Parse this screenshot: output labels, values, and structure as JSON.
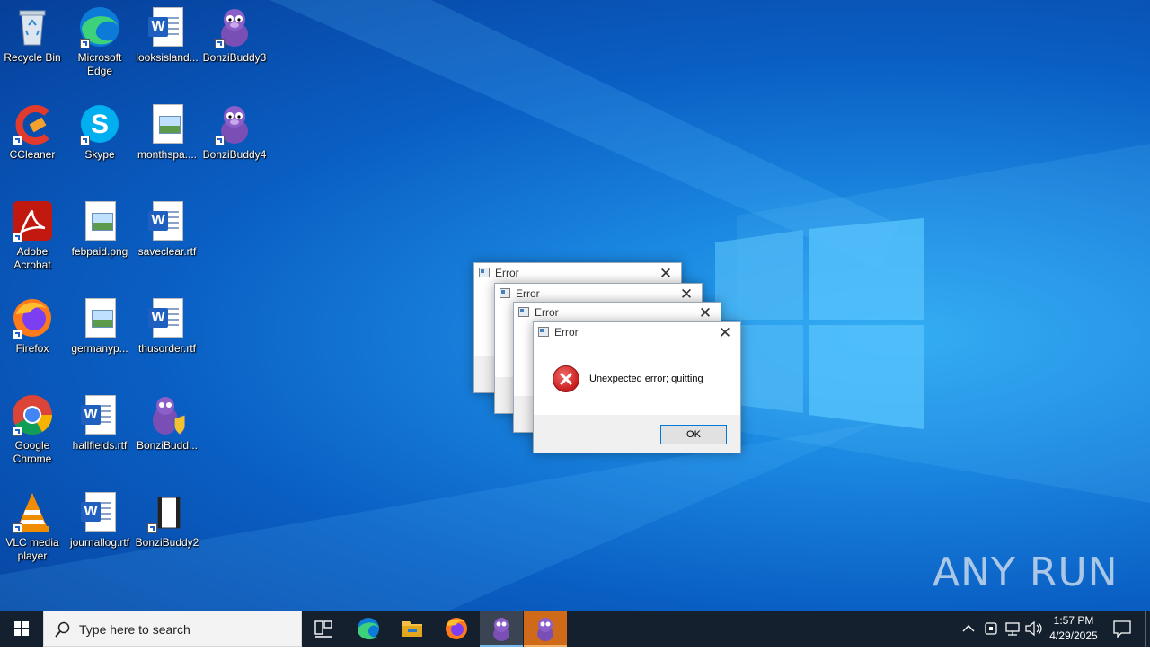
{
  "desktop": {
    "icons": [
      {
        "label": "Recycle Bin",
        "icon": "recycle-bin-icon"
      },
      {
        "label": "Microsoft Edge",
        "icon": "edge-icon"
      },
      {
        "label": "looksisland...",
        "icon": "word-doc-icon"
      },
      {
        "label": "BonziBuddy3",
        "icon": "bonzibuddy-icon"
      },
      {
        "label": "CCleaner",
        "icon": "ccleaner-icon"
      },
      {
        "label": "Skype",
        "icon": "skype-icon"
      },
      {
        "label": "monthspa....",
        "icon": "image-file-icon"
      },
      {
        "label": "BonziBuddy4",
        "icon": "bonzibuddy-icon"
      },
      {
        "label": "Adobe Acrobat",
        "icon": "acrobat-icon"
      },
      {
        "label": "febpaid.png",
        "icon": "image-file-icon"
      },
      {
        "label": "saveclear.rtf",
        "icon": "word-doc-icon"
      },
      {
        "label": "Firefox",
        "icon": "firefox-icon"
      },
      {
        "label": "germanyp...",
        "icon": "image-file-icon"
      },
      {
        "label": "thusorder.rtf",
        "icon": "word-doc-icon"
      },
      {
        "label": "Google Chrome",
        "icon": "chrome-icon"
      },
      {
        "label": "hallfields.rtf",
        "icon": "word-doc-icon"
      },
      {
        "label": "BonziBudd...",
        "icon": "bonzibuddy-installer-icon"
      },
      {
        "label": "VLC media player",
        "icon": "vlc-icon"
      },
      {
        "label": "journallog.rtf",
        "icon": "word-doc-icon"
      },
      {
        "label": "BonziBuddy2",
        "icon": "film-file-icon"
      }
    ]
  },
  "dialogs": [
    {
      "title": "Error"
    },
    {
      "title": "Error"
    },
    {
      "title": "Error"
    },
    {
      "title": "Error",
      "message": "Unexpected error; quitting",
      "ok_label": "OK"
    }
  ],
  "taskbar": {
    "search_placeholder": "Type here to search",
    "pinned": [
      "task-view-icon",
      "edge-icon",
      "file-explorer-icon",
      "firefox-icon",
      "bonzibuddy-icon",
      "bonzibuddy-icon"
    ],
    "clock_time": "1:57 PM",
    "clock_date": "4/29/2025"
  },
  "watermark": "ANY RUN",
  "colors": {
    "accent": "#0078d7",
    "taskbar": "#14202e",
    "active_orange": "#cf6a1a",
    "error_red": "#c91d1d"
  }
}
